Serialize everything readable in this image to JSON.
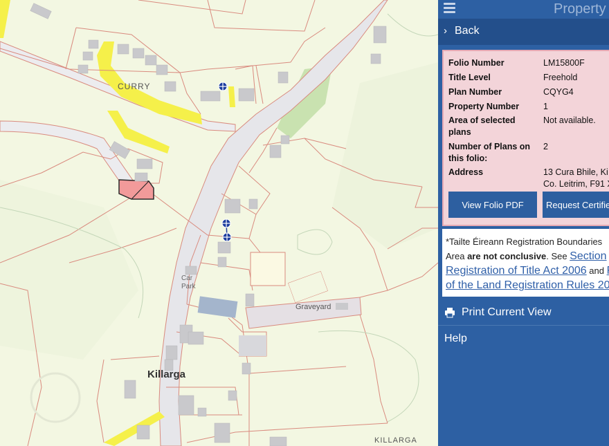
{
  "map": {
    "labels": {
      "curry": "CURRY",
      "killarga": "Killarga",
      "killarga_small": "KILLARGA",
      "graveyard": "Graveyard",
      "car": "Car",
      "park": "Park"
    },
    "colors": {
      "background": "#f3f7e2",
      "boundary": "#d98a7e",
      "road": "#e8e8ec",
      "highlight": "#f5f04a",
      "selected_plot": "#f29a9a",
      "building": "#c9c9cc",
      "marker": "#1d3d9e"
    }
  },
  "panel": {
    "title": "Property",
    "back_label": "Back",
    "info": {
      "folio_number_label": "Folio Number",
      "folio_number": "LM15800F",
      "title_level_label": "Title Level",
      "title_level": "Freehold",
      "plan_number_label": "Plan Number",
      "plan_number": "CQYG4",
      "property_number_label": "Property Number",
      "property_number": "1",
      "area_label_1": "Area of selected",
      "area_label_2": "plans",
      "area_value": "Not available.",
      "plans_label_1": "Number of Plans on",
      "plans_label_2": "this folio:",
      "plans_value": "2",
      "address_label": "Address",
      "address_line_1": "13 Cura Bhile, Ki",
      "address_line_2": "Co. Leitrim, F91 X"
    },
    "buttons": {
      "view_pdf": "View Folio PDF",
      "request_cert": "Request Certifie"
    },
    "notice": {
      "line1": "*Tailte Éireann Registration Boundaries",
      "line2_a": "Area ",
      "line2_b": "are not conclusive",
      "line2_c": ". See ",
      "line2_link": "Section",
      "line3_link": "Registration of Title Act 2006",
      "line3_and": " and ",
      "line3_link2": "R",
      "line4_link": "of the Land Registration Rules 201"
    },
    "print_label": "Print Current View",
    "help_label": "Help",
    "colors": {
      "panel_bg": "#2d60a3",
      "back_bg": "#234f8b",
      "info_bg": "#f3d4d9",
      "button_bg": "#2d5fa0",
      "link": "#2f5fa8"
    }
  }
}
